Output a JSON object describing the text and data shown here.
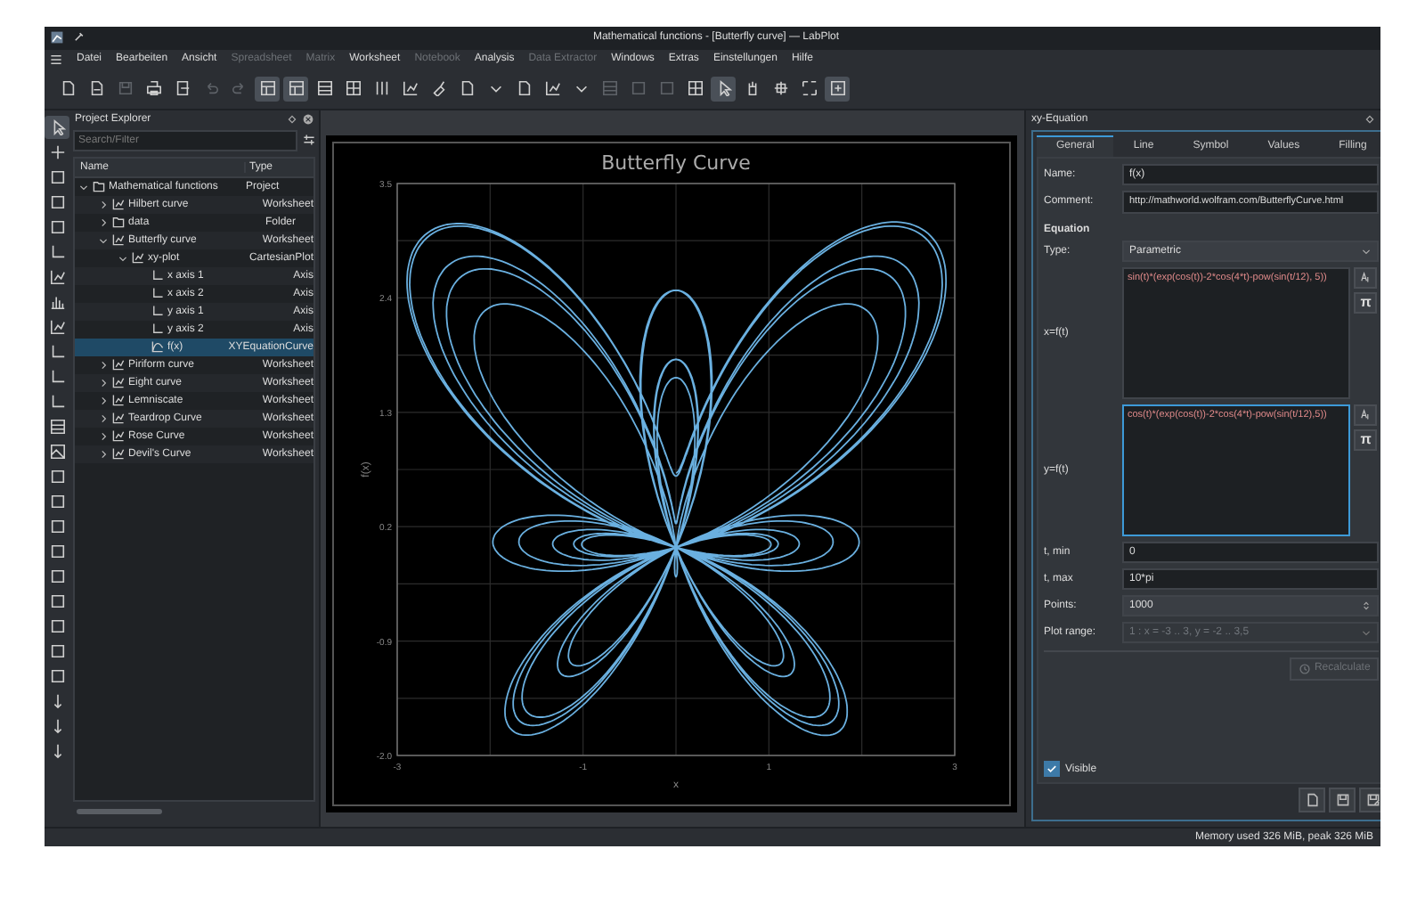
{
  "window": {
    "title": "Mathematical functions - [Butterfly curve] — LabPlot"
  },
  "menu": [
    {
      "label": "Datei",
      "disabled": false
    },
    {
      "label": "Bearbeiten",
      "disabled": false
    },
    {
      "label": "Ansicht",
      "disabled": false
    },
    {
      "label": "Spreadsheet",
      "disabled": true
    },
    {
      "label": "Matrix",
      "disabled": true
    },
    {
      "label": "Worksheet",
      "disabled": false
    },
    {
      "label": "Notebook",
      "disabled": true
    },
    {
      "label": "Analysis",
      "disabled": false
    },
    {
      "label": "Data Extractor",
      "disabled": true
    },
    {
      "label": "Windows",
      "disabled": false
    },
    {
      "label": "Extras",
      "disabled": false
    },
    {
      "label": "Einstellungen",
      "disabled": false
    },
    {
      "label": "Hilfe",
      "disabled": false
    }
  ],
  "toolbar": [
    {
      "selected": false,
      "disabled": false
    },
    {
      "selected": false,
      "disabled": false
    },
    {
      "selected": false,
      "disabled": true
    },
    {
      "selected": false,
      "disabled": false
    },
    {
      "selected": false,
      "disabled": false
    },
    {
      "selected": false,
      "disabled": true
    },
    {
      "selected": false,
      "disabled": true
    },
    {
      "selected": true,
      "disabled": false
    },
    {
      "selected": true,
      "disabled": false
    },
    {
      "selected": false,
      "disabled": false
    },
    {
      "selected": false,
      "disabled": false
    },
    {
      "selected": false,
      "disabled": false
    },
    {
      "selected": false,
      "disabled": false
    },
    {
      "selected": false,
      "disabled": false
    },
    {
      "selected": false,
      "disabled": false
    },
    {
      "selected": false,
      "disabled": false
    },
    {
      "selected": false,
      "disabled": false
    },
    {
      "selected": false,
      "disabled": false
    },
    {
      "selected": false,
      "disabled": false
    },
    {
      "selected": false,
      "disabled": true
    },
    {
      "selected": false,
      "disabled": true
    },
    {
      "selected": false,
      "disabled": true
    },
    {
      "selected": false,
      "disabled": false
    },
    {
      "selected": true,
      "disabled": false
    },
    {
      "selected": false,
      "disabled": false
    },
    {
      "selected": false,
      "disabled": false
    },
    {
      "selected": false,
      "disabled": false
    },
    {
      "selected": true,
      "disabled": false
    }
  ],
  "left_toolbar": [
    {
      "selected": true
    },
    {
      "selected": false
    },
    {
      "selected": false
    },
    {
      "selected": false
    },
    {
      "selected": false
    },
    {
      "selected": false
    },
    {
      "selected": false
    },
    {
      "selected": false
    },
    {
      "selected": false
    },
    {
      "selected": false
    },
    {
      "selected": false
    },
    {
      "selected": false
    },
    {
      "selected": false
    },
    {
      "selected": false
    },
    {
      "selected": false
    },
    {
      "selected": false
    },
    {
      "selected": false
    },
    {
      "selected": false
    },
    {
      "selected": false
    },
    {
      "selected": false
    },
    {
      "selected": false
    },
    {
      "selected": false
    },
    {
      "selected": false
    },
    {
      "selected": false
    },
    {
      "selected": false
    },
    {
      "selected": false
    }
  ],
  "project_explorer": {
    "title": "Project Explorer",
    "search": {
      "placeholder": "Search/Filter"
    },
    "columns": [
      "Name",
      "Type"
    ],
    "tree": [
      {
        "name": "Mathematical functions",
        "type": "Project",
        "kind": "project",
        "expanded": true,
        "selected": false,
        "children": [
          {
            "name": "Hilbert curve",
            "type": "Worksheet",
            "kind": "worksheet",
            "expanded": false,
            "selected": false
          },
          {
            "name": "data",
            "type": "Folder",
            "kind": "folder",
            "expanded": false,
            "selected": false
          },
          {
            "name": "Butterfly curve",
            "type": "Worksheet",
            "kind": "worksheet",
            "expanded": true,
            "selected": false,
            "children": [
              {
                "name": "xy-plot",
                "type": "CartesianPlot",
                "kind": "plot",
                "expanded": true,
                "selected": false,
                "children": [
                  {
                    "name": "x axis 1",
                    "type": "Axis",
                    "kind": "axis",
                    "selected": false
                  },
                  {
                    "name": "x axis 2",
                    "type": "Axis",
                    "kind": "axis",
                    "selected": false
                  },
                  {
                    "name": "y axis 1",
                    "type": "Axis",
                    "kind": "axis",
                    "selected": false
                  },
                  {
                    "name": "y axis 2",
                    "type": "Axis",
                    "kind": "axis",
                    "selected": false
                  },
                  {
                    "name": "f(x)",
                    "type": "XYEquationCurve",
                    "kind": "curve",
                    "selected": true
                  }
                ]
              }
            ]
          },
          {
            "name": "Piriform curve",
            "type": "Worksheet",
            "kind": "worksheet",
            "expanded": false,
            "selected": false
          },
          {
            "name": "Eight curve",
            "type": "Worksheet",
            "kind": "worksheet",
            "expanded": false,
            "selected": false
          },
          {
            "name": "Lemniscate",
            "type": "Worksheet",
            "kind": "worksheet",
            "expanded": false,
            "selected": false
          },
          {
            "name": "Teardrop Curve",
            "type": "Worksheet",
            "kind": "worksheet",
            "expanded": false,
            "selected": false
          },
          {
            "name": "Rose Curve",
            "type": "Worksheet",
            "kind": "worksheet",
            "expanded": false,
            "selected": false
          },
          {
            "name": "Devil's Curve",
            "type": "Worksheet",
            "kind": "worksheet",
            "expanded": false,
            "selected": false
          }
        ]
      }
    ]
  },
  "worksheet": {
    "chart_data": {
      "type": "line",
      "title": "Butterfly Curve",
      "xlabel": "x",
      "ylabel": "f(x)",
      "xlim": [
        -3,
        3
      ],
      "ylim": [
        -2,
        3.5
      ],
      "xticks": [
        {
          "value": -3,
          "label": "-3"
        },
        {
          "value": -1,
          "label": "-1"
        },
        {
          "value": 1,
          "label": "1"
        },
        {
          "value": 3,
          "label": "3"
        }
      ],
      "grid": true,
      "yticks": [
        {
          "value": 3.5,
          "label": "3.5"
        },
        {
          "value": 2.4,
          "label": "2.4"
        },
        {
          "value": 1.3,
          "label": "1.3"
        },
        {
          "value": 0.2,
          "label": "0.2"
        },
        {
          "value": -0.9,
          "label": "-0.9"
        },
        {
          "value": -2,
          "label": "-2.0"
        }
      ]
    }
  },
  "dock": {
    "title": "xy-Equation",
    "tabs": [
      {
        "label": "General",
        "selected": true
      },
      {
        "label": "Line",
        "selected": false
      },
      {
        "label": "Symbol",
        "selected": false
      },
      {
        "label": "Values",
        "selected": false
      },
      {
        "label": "Filling",
        "selected": false
      }
    ],
    "name": {
      "label": "Name:",
      "value": "f(x)"
    },
    "comment": {
      "label": "Comment:",
      "value": "http://mathworld.wolfram.com/ButterflyCurve.html"
    },
    "section": "Equation",
    "type": {
      "label": "Type:",
      "value": "Parametric"
    },
    "x_equation": {
      "label": "x=f(t)",
      "value": "sin(t)*(exp(cos(t))-2*cos(4*t)-pow(sin(t/12), 5))",
      "pi": "π",
      "focused": false
    },
    "y_equation": {
      "label": "y=f(t)",
      "value": "cos(t)*(exp(cos(t))-2*cos(4*t)-pow(sin(t/12),5))",
      "pi": "π",
      "focused": true
    },
    "t_min": {
      "label": "t, min",
      "value": "0"
    },
    "t_max": {
      "label": "t, max",
      "value": "10*pi"
    },
    "points": {
      "label": "Points:",
      "value": "1000"
    },
    "plot_range": {
      "label": "Plot range:",
      "value": "1 : x = -3 .. 3, y = -2 .. 3,5",
      "disabled": true
    },
    "recalculate": {
      "label": "Recalculate",
      "disabled": true
    },
    "visible": {
      "label": "Visible",
      "checked": true
    }
  },
  "status_bar": "Memory used 326 MiB, peak 326 MiB"
}
